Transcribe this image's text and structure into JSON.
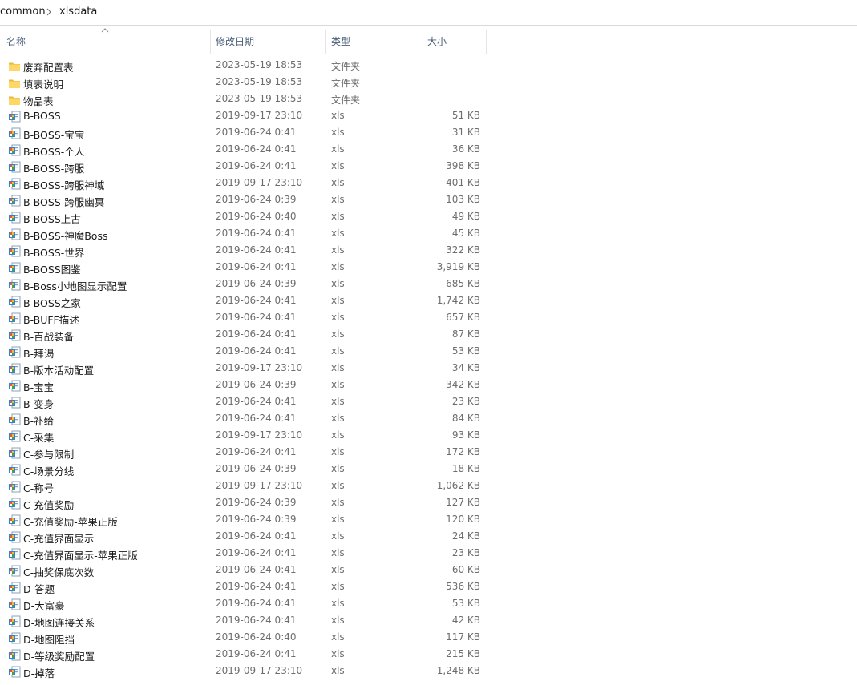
{
  "breadcrumb": {
    "parts": [
      "common",
      "xlsdata"
    ]
  },
  "columns": {
    "name": "名称",
    "date": "修改日期",
    "type": "类型",
    "size": "大小"
  },
  "files": [
    {
      "name": "废弃配置表",
      "date": "2023-05-19 18:53",
      "type": "文件夹",
      "size": "",
      "icon": "folder"
    },
    {
      "name": "填表说明",
      "date": "2023-05-19 18:53",
      "type": "文件夹",
      "size": "",
      "icon": "folder"
    },
    {
      "name": "物品表",
      "date": "2023-05-19 18:53",
      "type": "文件夹",
      "size": "",
      "icon": "folder"
    },
    {
      "name": "B-BOSS",
      "date": "2019-09-17 23:10",
      "type": "xls",
      "size": "51 KB",
      "icon": "xls"
    },
    {
      "name": "B-BOSS-宝宝",
      "date": "2019-06-24 0:41",
      "type": "xls",
      "size": "31 KB",
      "icon": "xls"
    },
    {
      "name": "B-BOSS-个人",
      "date": "2019-06-24 0:41",
      "type": "xls",
      "size": "36 KB",
      "icon": "xls"
    },
    {
      "name": "B-BOSS-跨服",
      "date": "2019-06-24 0:41",
      "type": "xls",
      "size": "398 KB",
      "icon": "xls"
    },
    {
      "name": "B-BOSS-跨服神域",
      "date": "2019-09-17 23:10",
      "type": "xls",
      "size": "401 KB",
      "icon": "xls"
    },
    {
      "name": "B-BOSS-跨服幽冥",
      "date": "2019-06-24 0:39",
      "type": "xls",
      "size": "103 KB",
      "icon": "xls"
    },
    {
      "name": "B-BOSS上古",
      "date": "2019-06-24 0:40",
      "type": "xls",
      "size": "49 KB",
      "icon": "xls"
    },
    {
      "name": "B-BOSS-神魔Boss",
      "date": "2019-06-24 0:41",
      "type": "xls",
      "size": "45 KB",
      "icon": "xls"
    },
    {
      "name": "B-BOSS-世界",
      "date": "2019-06-24 0:41",
      "type": "xls",
      "size": "322 KB",
      "icon": "xls"
    },
    {
      "name": "B-BOSS图鉴",
      "date": "2019-06-24 0:41",
      "type": "xls",
      "size": "3,919 KB",
      "icon": "xls"
    },
    {
      "name": "B-Boss小地图显示配置",
      "date": "2019-06-24 0:39",
      "type": "xls",
      "size": "685 KB",
      "icon": "xls"
    },
    {
      "name": "B-BOSS之家",
      "date": "2019-06-24 0:41",
      "type": "xls",
      "size": "1,742 KB",
      "icon": "xls"
    },
    {
      "name": "B-BUFF描述",
      "date": "2019-06-24 0:41",
      "type": "xls",
      "size": "657 KB",
      "icon": "xls"
    },
    {
      "name": "B-百战装备",
      "date": "2019-06-24 0:41",
      "type": "xls",
      "size": "87 KB",
      "icon": "xls"
    },
    {
      "name": "B-拜谒",
      "date": "2019-06-24 0:41",
      "type": "xls",
      "size": "53 KB",
      "icon": "xls"
    },
    {
      "name": "B-版本活动配置",
      "date": "2019-09-17 23:10",
      "type": "xls",
      "size": "34 KB",
      "icon": "xls"
    },
    {
      "name": "B-宝宝",
      "date": "2019-06-24 0:39",
      "type": "xls",
      "size": "342 KB",
      "icon": "xls"
    },
    {
      "name": "B-变身",
      "date": "2019-06-24 0:41",
      "type": "xls",
      "size": "23 KB",
      "icon": "xls"
    },
    {
      "name": "B-补给",
      "date": "2019-06-24 0:41",
      "type": "xls",
      "size": "84 KB",
      "icon": "xls"
    },
    {
      "name": "C-采集",
      "date": "2019-09-17 23:10",
      "type": "xls",
      "size": "93 KB",
      "icon": "xls"
    },
    {
      "name": "C-参与限制",
      "date": "2019-06-24 0:41",
      "type": "xls",
      "size": "172 KB",
      "icon": "xls"
    },
    {
      "name": "C-场景分线",
      "date": "2019-06-24 0:39",
      "type": "xls",
      "size": "18 KB",
      "icon": "xls"
    },
    {
      "name": "C-称号",
      "date": "2019-09-17 23:10",
      "type": "xls",
      "size": "1,062 KB",
      "icon": "xls"
    },
    {
      "name": "C-充值奖励",
      "date": "2019-06-24 0:39",
      "type": "xls",
      "size": "127 KB",
      "icon": "xls"
    },
    {
      "name": "C-充值奖励-苹果正版",
      "date": "2019-06-24 0:39",
      "type": "xls",
      "size": "120 KB",
      "icon": "xls"
    },
    {
      "name": "C-充值界面显示",
      "date": "2019-06-24 0:41",
      "type": "xls",
      "size": "24 KB",
      "icon": "xls"
    },
    {
      "name": "C-充值界面显示-苹果正版",
      "date": "2019-06-24 0:41",
      "type": "xls",
      "size": "23 KB",
      "icon": "xls"
    },
    {
      "name": "C-抽奖保底次数",
      "date": "2019-06-24 0:41",
      "type": "xls",
      "size": "60 KB",
      "icon": "xls"
    },
    {
      "name": "D-答题",
      "date": "2019-06-24 0:41",
      "type": "xls",
      "size": "536 KB",
      "icon": "xls"
    },
    {
      "name": "D-大富豪",
      "date": "2019-06-24 0:41",
      "type": "xls",
      "size": "53 KB",
      "icon": "xls"
    },
    {
      "name": "D-地图连接关系",
      "date": "2019-06-24 0:41",
      "type": "xls",
      "size": "42 KB",
      "icon": "xls"
    },
    {
      "name": "D-地图阻挡",
      "date": "2019-06-24 0:40",
      "type": "xls",
      "size": "117 KB",
      "icon": "xls"
    },
    {
      "name": "D-等级奖励配置",
      "date": "2019-06-24 0:41",
      "type": "xls",
      "size": "215 KB",
      "icon": "xls"
    },
    {
      "name": "D-掉落",
      "date": "2019-09-17 23:10",
      "type": "xls",
      "size": "1,248 KB",
      "icon": "xls"
    }
  ]
}
